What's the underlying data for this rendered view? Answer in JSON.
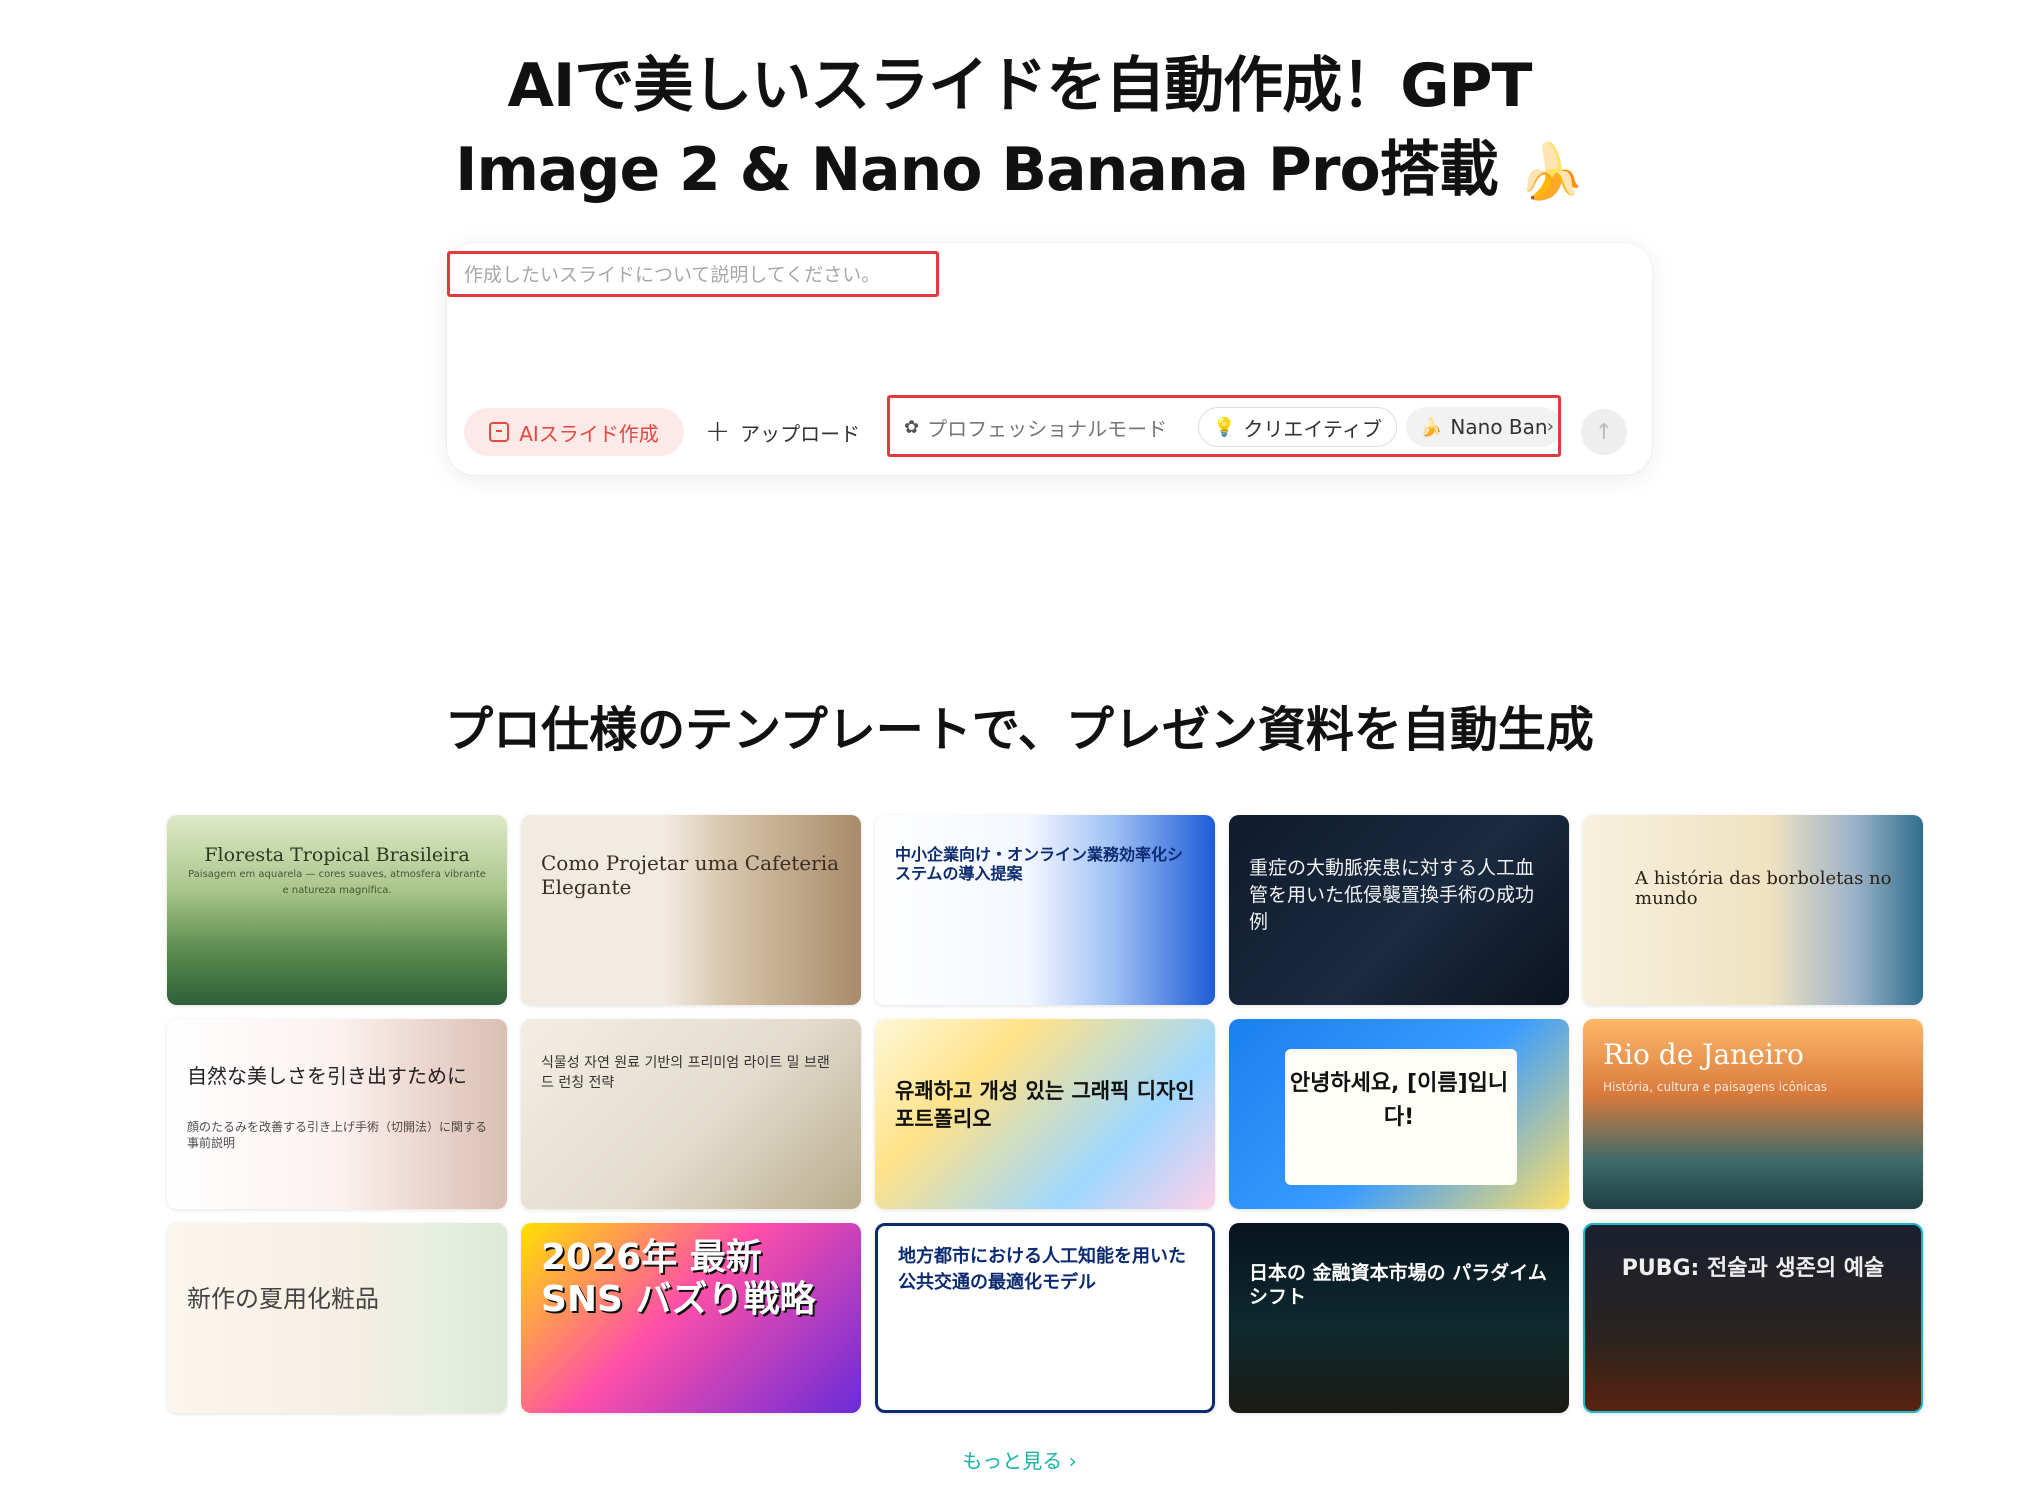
{
  "hero": {
    "title_line1": "AIで美しいスライドを自動作成！GPT",
    "title_line2": "Image 2 & Nano Banana Pro搭載",
    "title_emoji": "🍌"
  },
  "composer": {
    "placeholder": "作成したいスライドについて説明してください。",
    "ai_button_label": "AIスライド作成",
    "upload_label": "アップロード",
    "options": {
      "professional_mode": "プロフェッショナルモード",
      "creative": "クリエイティブ",
      "nano_banana": "Nano Ban"
    },
    "send_icon": "arrow-up-icon"
  },
  "templates": {
    "section_title": "プロ仕様のテンプレートで、プレゼン資料を自動生成",
    "cards": [
      {
        "title": "Floresta Tropical Brasileira",
        "subtitle": "Paisagem em aquarela — cores suaves, atmosfera vibrante e natureza magnífica."
      },
      {
        "title": "Como Projetar uma Cafeteria Elegante",
        "subtitle": ""
      },
      {
        "title": "中小企業向け・オンライン業務効率化システムの導入提案",
        "subtitle": ""
      },
      {
        "title": "重症の大動脈疾患に対する人工血管を用いた低侵襲置換手術の成功例",
        "subtitle": ""
      },
      {
        "title": "A história das borboletas no mundo",
        "subtitle": ""
      },
      {
        "title": "自然な美しさを引き出すために",
        "subtitle": "顔のたるみを改善する引き上げ手術（切開法）に関する事前説明"
      },
      {
        "title": "식물성 자연 원료 기반의 프리미엄 라이트 밀 브랜드 런칭 전략",
        "subtitle": ""
      },
      {
        "title": "유쾌하고 개성 있는 그래픽 디자인 포트폴리오",
        "subtitle": ""
      },
      {
        "title": "안녕하세요, [이름]입니다!",
        "subtitle": ""
      },
      {
        "title": "Rio de Janeiro",
        "subtitle": "História, cultura e paisagens icônicas"
      },
      {
        "title": "新作の夏用化粧品",
        "subtitle": ""
      },
      {
        "title": "2026年 最新SNS バズり戦略",
        "subtitle": ""
      },
      {
        "title": "地方都市における人工知能を用いた公共交通の最適化モデル",
        "subtitle": ""
      },
      {
        "title": "日本の 金融資本市場の パラダイムシフト",
        "subtitle": ""
      },
      {
        "title": "PUBG: 전술과 생존의 예술",
        "subtitle": ""
      }
    ]
  },
  "more_link": "もっと見る ›"
}
